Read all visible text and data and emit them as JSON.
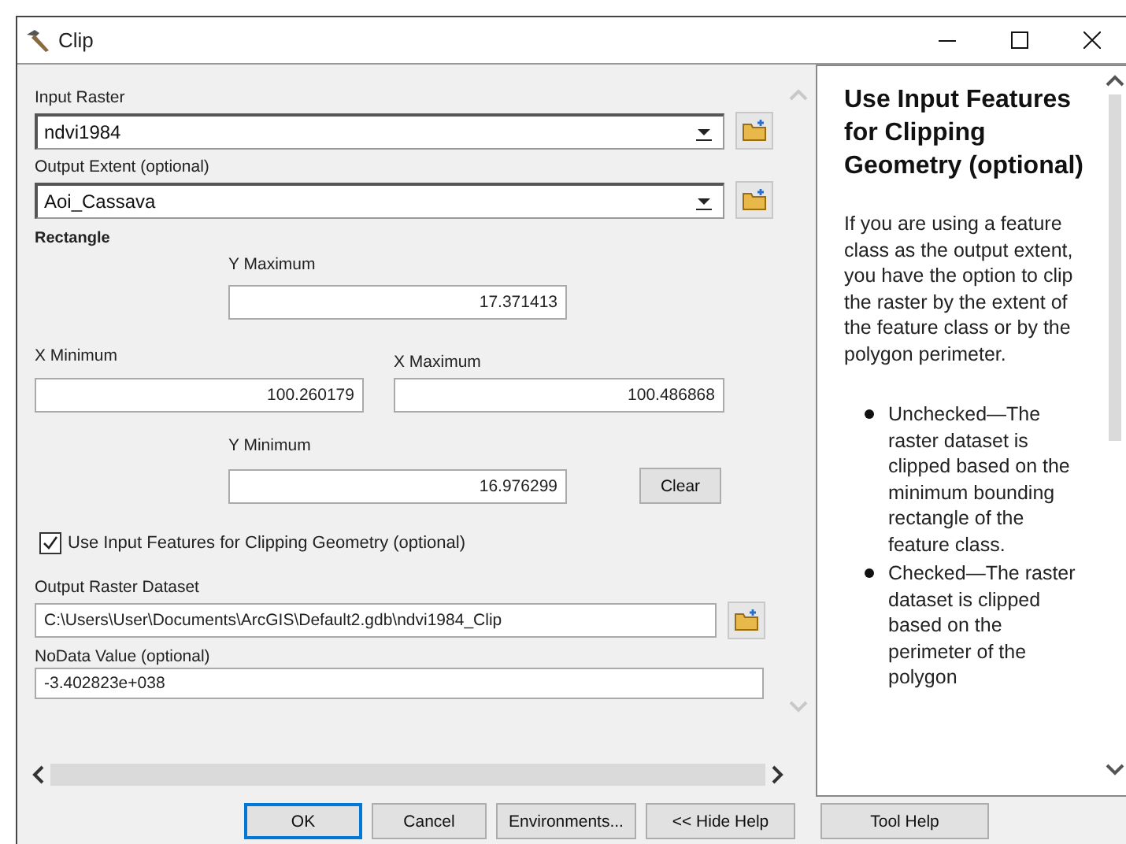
{
  "window": {
    "title": "Clip"
  },
  "parameters": [
    {
      "label": "Input Raster",
      "value": "ndvi1984"
    },
    {
      "label": "Output Extent (optional)",
      "value": "Aoi_Cassava"
    }
  ],
  "rectangle": {
    "label": "Rectangle",
    "y_maximum": {
      "label": "Y Maximum",
      "value": "17.371413"
    },
    "x_minimum": {
      "label": "X Minimum",
      "value": "100.260179"
    },
    "x_maximum": {
      "label": "X Maximum",
      "value": "100.486868"
    },
    "y_minimum": {
      "label": "Y Minimum",
      "value": "16.976299"
    },
    "clear": "Clear"
  },
  "clip_geometry": {
    "label": "Use Input Features for Clipping Geometry (optional)",
    "checked": true
  },
  "output_raster": {
    "label": "Output Raster Dataset",
    "value": "C:\\Users\\User\\Documents\\ArcGIS\\Default2.gdb\\ndvi1984_Clip"
  },
  "nodata": {
    "label": "NoData Value (optional)",
    "value": "-3.402823e+038"
  },
  "help": {
    "title": "Use Input Features for Clipping Geometry (optional)",
    "paragraph": "If you are using a feature class as the output extent, you have the option to clip the raster by the extent of the feature class or by the polygon perimeter.",
    "bullets": [
      "Unchecked—The raster dataset is clipped based on the minimum bounding rectangle of the feature class.",
      "Checked—The raster dataset is clipped based on the perimeter of the polygon"
    ]
  },
  "buttons": [
    {
      "label": "OK",
      "focused": true
    },
    {
      "label": "Cancel",
      "focused": false
    },
    {
      "label": "Environments...",
      "focused": false
    },
    {
      "label": "<< Hide Help",
      "focused": false
    }
  ],
  "help_button": {
    "label": "Tool Help"
  }
}
